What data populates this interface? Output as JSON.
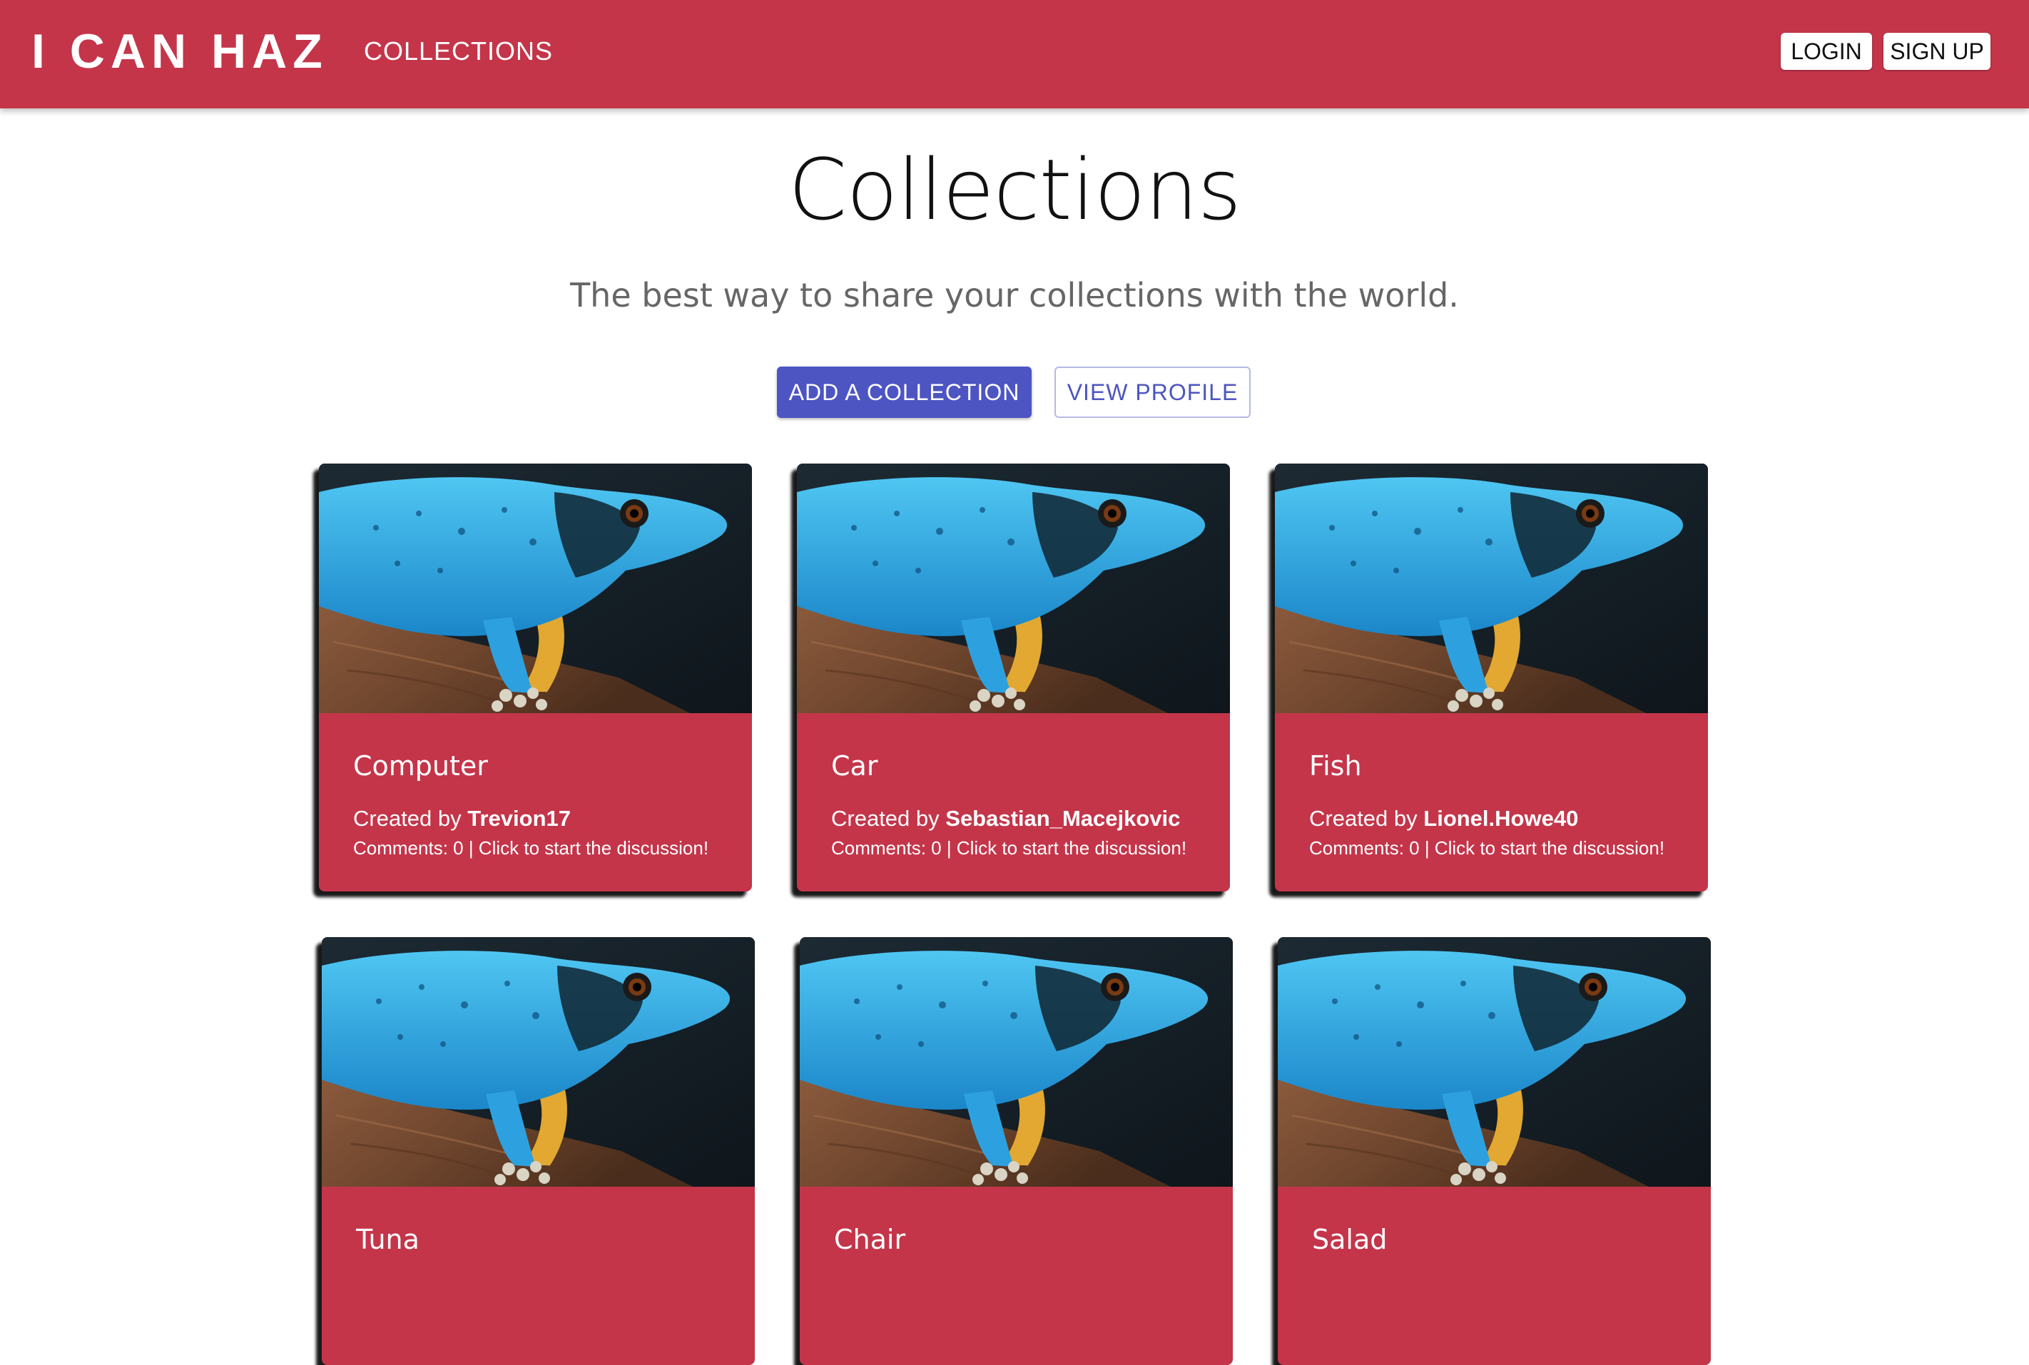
{
  "header": {
    "brand": "I CAN HAZ",
    "nav_collections": "COLLECTIONS",
    "login_label": "LOGIN",
    "signup_label": "SIGN UP"
  },
  "hero": {
    "title": "Collections",
    "subtitle": "The best way to share your collections with the world.",
    "add_collection_label": "ADD A COLLECTION",
    "view_profile_label": "VIEW PROFILE"
  },
  "colors": {
    "brand_red": "#c4354a",
    "primary_blue": "#4d55c2"
  },
  "cards": [
    {
      "title": "Computer",
      "created_prefix": "Created by ",
      "author": "Trevion17",
      "comments": "Comments: 0 | Click to start the discussion!",
      "image": "blue-gecko-photo"
    },
    {
      "title": "Car",
      "created_prefix": "Created by ",
      "author": "Sebastian_Macejkovic",
      "comments": "Comments: 0 | Click to start the discussion!",
      "image": "blue-gecko-photo"
    },
    {
      "title": "Fish",
      "created_prefix": "Created by ",
      "author": "Lionel.Howe40",
      "comments": "Comments: 0 | Click to start the discussion!",
      "image": "blue-gecko-photo"
    },
    {
      "title": "Tuna",
      "image": "blue-gecko-photo"
    },
    {
      "title": "Chair",
      "image": "blue-gecko-photo"
    },
    {
      "title": "Salad",
      "image": "blue-gecko-photo"
    }
  ]
}
